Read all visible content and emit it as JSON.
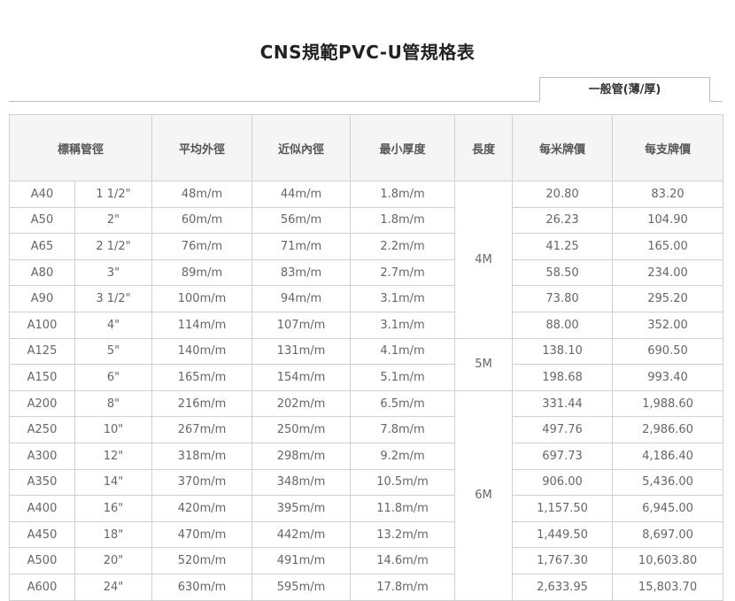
{
  "page": {
    "title": "CNS規範PVC-U管規格表",
    "tab_label": "一般管(薄/厚)"
  },
  "table": {
    "headers": [
      "標稱管徑",
      "平均外徑",
      "近似內徑",
      "最小厚度",
      "長度",
      "每米牌價",
      "每支牌價"
    ],
    "lengths": [
      "4M",
      "5M",
      "6M"
    ],
    "rows": [
      [
        "A40",
        "1 1/2\"",
        "48m/m",
        "44m/m",
        "1.8m/m",
        "20.80",
        "83.20"
      ],
      [
        "A50",
        "2\"",
        "60m/m",
        "56m/m",
        "1.8m/m",
        "26.23",
        "104.90"
      ],
      [
        "A65",
        "2 1/2\"",
        "76m/m",
        "71m/m",
        "2.2m/m",
        "41.25",
        "165.00"
      ],
      [
        "A80",
        "3\"",
        "89m/m",
        "83m/m",
        "2.7m/m",
        "58.50",
        "234.00"
      ],
      [
        "A90",
        "3 1/2\"",
        "100m/m",
        "94m/m",
        "3.1m/m",
        "73.80",
        "295.20"
      ],
      [
        "A100",
        "4\"",
        "114m/m",
        "107m/m",
        "3.1m/m",
        "88.00",
        "352.00"
      ],
      [
        "A125",
        "5\"",
        "140m/m",
        "131m/m",
        "4.1m/m",
        "138.10",
        "690.50"
      ],
      [
        "A150",
        "6\"",
        "165m/m",
        "154m/m",
        "5.1m/m",
        "198.68",
        "993.40"
      ],
      [
        "A200",
        "8\"",
        "216m/m",
        "202m/m",
        "6.5m/m",
        "331.44",
        "1,988.60"
      ],
      [
        "A250",
        "10\"",
        "267m/m",
        "250m/m",
        "7.8m/m",
        "497.76",
        "2,986.60"
      ],
      [
        "A300",
        "12\"",
        "318m/m",
        "298m/m",
        "9.2m/m",
        "697.73",
        "4,186.40"
      ],
      [
        "A350",
        "14\"",
        "370m/m",
        "348m/m",
        "10.5m/m",
        "906.00",
        "5,436.00"
      ],
      [
        "A400",
        "16\"",
        "420m/m",
        "395m/m",
        "11.8m/m",
        "1,157.50",
        "6,945.00"
      ],
      [
        "A450",
        "18\"",
        "470m/m",
        "442m/m",
        "13.2m/m",
        "1,449.50",
        "8,697.00"
      ],
      [
        "A500",
        "20\"",
        "520m/m",
        "491m/m",
        "14.6m/m",
        "1,767.30",
        "10,603.80"
      ],
      [
        "A600",
        "24\"",
        "630m/m",
        "595m/m",
        "17.8m/m",
        "2,633.95",
        "15,803.70"
      ]
    ]
  }
}
